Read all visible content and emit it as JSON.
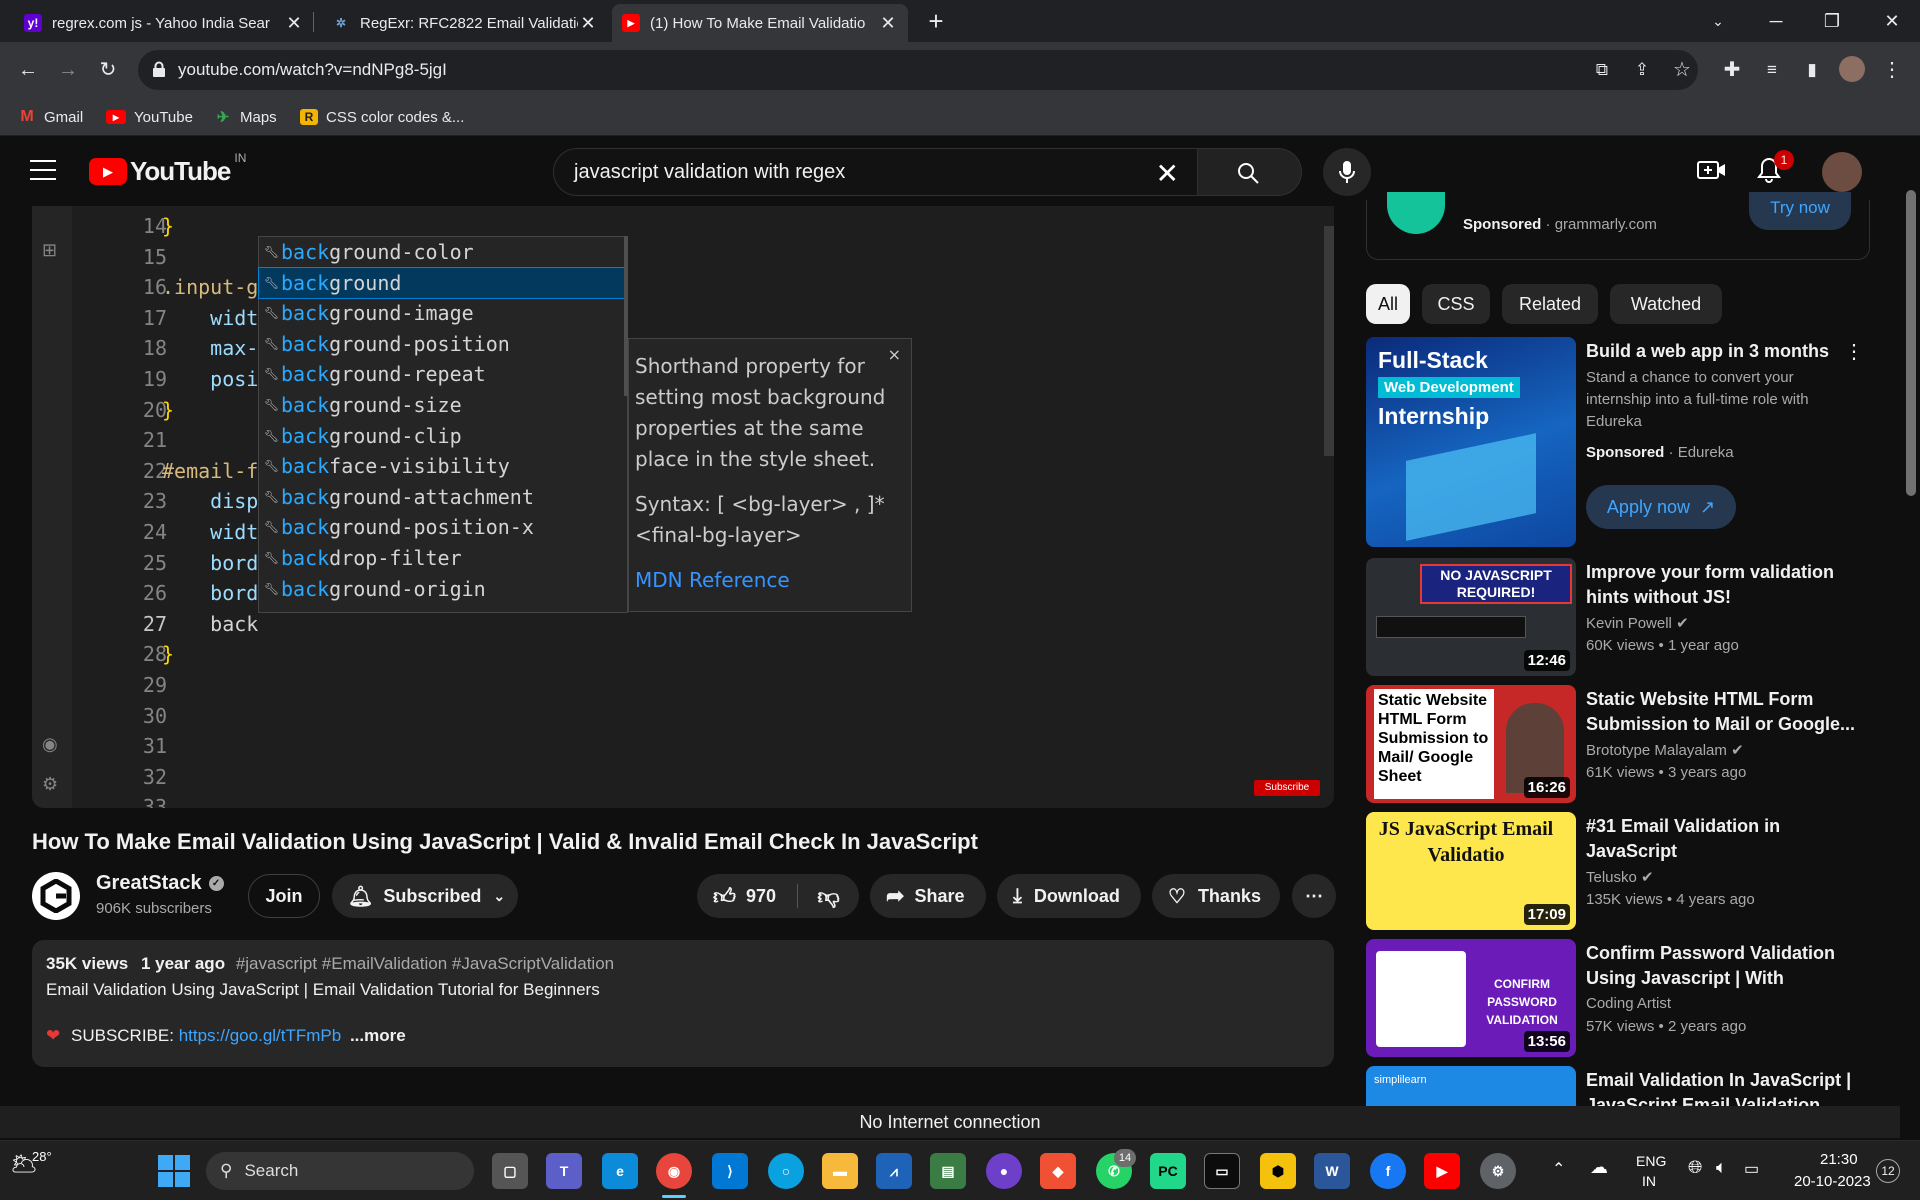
{
  "browser": {
    "tabs": [
      {
        "title": "regrex.com js - Yahoo India Sear",
        "favicon": "yahoo-icon",
        "color": "#6001d2"
      },
      {
        "title": "RegExr: RFC2822 Email Validatio",
        "favicon": "regexr-icon",
        "color": "#70a0d8"
      },
      {
        "title": "(1) How To Make Email Validatio",
        "favicon": "youtube-icon",
        "color": "#ff0000"
      }
    ],
    "url": "youtube.com/watch?v=ndNPg8-5jgI",
    "bookmarks": [
      {
        "label": "Gmail",
        "icon": "gmail-icon"
      },
      {
        "label": "YouTube",
        "icon": "youtube-icon"
      },
      {
        "label": "Maps",
        "icon": "maps-icon"
      },
      {
        "label": "CSS color codes &...",
        "icon": "css-icon"
      }
    ]
  },
  "youtube": {
    "logo_text": "YouTube",
    "country": "IN",
    "search_query": "javascript validation with regex",
    "notification_count": "1"
  },
  "editor": {
    "line_numbers": [
      "14",
      "15",
      "16",
      "17",
      "18",
      "19",
      "20",
      "21",
      "22",
      "23",
      "24",
      "25",
      "26",
      "27",
      "28",
      "29",
      "30",
      "31",
      "32",
      "33"
    ],
    "code_lines": [
      "}",
      "",
      ".input-g",
      "    widt",
      "    max-",
      "    posi",
      "}",
      "",
      "#email-f",
      "    disp",
      "    widt",
      "    bord",
      "    bord",
      "    back",
      "}",
      "",
      "",
      "",
      "",
      ""
    ],
    "suggestions": [
      {
        "prefix": "back",
        "rest": "ground-color"
      },
      {
        "prefix": "back",
        "rest": "ground"
      },
      {
        "prefix": "back",
        "rest": "ground-image"
      },
      {
        "prefix": "back",
        "rest": "ground-position"
      },
      {
        "prefix": "back",
        "rest": "ground-repeat"
      },
      {
        "prefix": "back",
        "rest": "ground-size"
      },
      {
        "prefix": "back",
        "rest": "ground-clip"
      },
      {
        "prefix": "back",
        "rest": "face-visibility"
      },
      {
        "prefix": "back",
        "rest": "ground-attachment"
      },
      {
        "prefix": "back",
        "rest": "ground-position-x"
      },
      {
        "prefix": "back",
        "rest": "drop-filter"
      },
      {
        "prefix": "back",
        "rest": "ground-origin"
      }
    ],
    "doc_text": "Shorthand property for setting most background properties at the same place in the style sheet.",
    "doc_syntax": "Syntax: [ <bg-layer> , ]* <final-bg-layer>",
    "doc_link": "MDN Reference",
    "subscribe_watermark": "Subscribe"
  },
  "video": {
    "title": "How To Make Email Validation Using JavaScript | Valid & Invalid Email Check In JavaScript",
    "channel": "GreatStack",
    "subscribers": "906K subscribers",
    "join": "Join",
    "subscribed": "Subscribed",
    "likes": "970",
    "share": "Share",
    "download": "Download",
    "thanks": "Thanks",
    "views": "35K views",
    "age": "1 year ago",
    "hashtags": "#javascript #EmailValidation #JavaScriptValidation",
    "desc_line": "Email Validation Using JavaScript | Email Validation Tutorial for Beginners",
    "subscribe_label": "SUBSCRIBE:",
    "subscribe_link": "https://goo.gl/tTFmPb",
    "more": "...more"
  },
  "sidebar": {
    "ad_top": {
      "sponsored": "Sponsored",
      "domain": "grammarly.com",
      "cta": "Try now"
    },
    "chips": [
      "All",
      "CSS",
      "Related",
      "Watched"
    ],
    "ad": {
      "title": "Build a web app in 3 months",
      "desc": "Stand a chance to convert your internship into a full-time role with Edureka",
      "sponsored": "Sponsored",
      "advertiser": "Edureka",
      "cta": "Apply now",
      "thumb_line1": "Full-Stack",
      "thumb_line2": "Web Development",
      "thumb_line3": "Internship"
    },
    "videos": [
      {
        "title": "Improve your form validation hints without JS!",
        "channel": "Kevin Powell",
        "meta": "60K views • 1 year ago",
        "duration": "12:46",
        "thumb_text": "NO JAVASCRIPT REQUIRED!",
        "verified": true
      },
      {
        "title": "Static Website HTML Form Submission to Mail or Google...",
        "channel": "Brototype Malayalam",
        "meta": "61K views • 3 years ago",
        "duration": "16:26",
        "thumb_text": "Static Website HTML Form Submission to Mail/ Google Sheet",
        "verified": true
      },
      {
        "title": "#31 Email Validation in JavaScript",
        "channel": "Telusko",
        "meta": "135K views • 4 years ago",
        "duration": "17:09",
        "thumb_text": "JS JavaScript Email Validatio",
        "verified": true
      },
      {
        "title": "Confirm Password Validation Using Javascript | With Source...",
        "channel": "Coding Artist",
        "meta": "57K views • 2 years ago",
        "duration": "13:56",
        "thumb_text": "CONFIRM PASSWORD VALIDATION",
        "verified": false
      },
      {
        "title": "Email Validation In JavaScript | JavaScript Email Validation",
        "channel": "",
        "meta": "",
        "duration": "",
        "thumb_text": "simplilearn",
        "verified": false
      }
    ]
  },
  "status": {
    "no_internet": "No Internet connection"
  },
  "taskbar": {
    "weather": "28°",
    "search": "Search",
    "whatsapp_badge": "14",
    "lang1": "ENG",
    "lang2": "IN",
    "time": "21:30",
    "date": "20-10-2023",
    "notif": "12"
  }
}
